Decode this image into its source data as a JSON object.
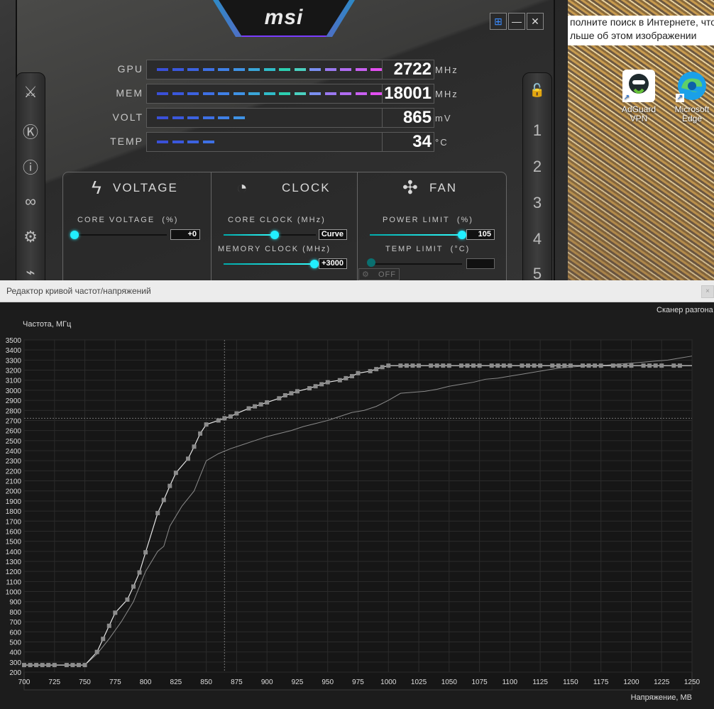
{
  "desktop": {
    "search_hint_line1": "полните поиск в Интернете, что",
    "search_hint_line2": "льше об этом изображении",
    "icons": [
      {
        "label_line1": "AdGuard",
        "label_line2": "VPN",
        "icon": "adguard-vpn-icon",
        "color": "#ffffff"
      },
      {
        "label_line1": "Microsoft",
        "label_line2": "Edge",
        "icon": "edge-icon",
        "color": "#1aa0e8"
      }
    ]
  },
  "msi": {
    "logo": "msi",
    "window_buttons": {
      "windows": "⊞",
      "minimize": "—",
      "close": "✕"
    },
    "left_rail": [
      "oc-scanner-icon",
      "k-icon",
      "info-icon",
      "oc-icon",
      "settings-icon",
      "monitor-icon"
    ],
    "left_rail_glyphs": [
      "⚔",
      "Ⓚ",
      "ⓘ",
      "∞",
      "⚙",
      "⌁"
    ],
    "profiles": {
      "lock_glyph": "🔓",
      "slots": [
        "1",
        "2",
        "3",
        "4",
        "5"
      ]
    },
    "stats": [
      {
        "label": "GPU",
        "value": "2722",
        "unit": "MHz",
        "segments": 15
      },
      {
        "label": "MEM",
        "value": "18001",
        "unit": "MHz",
        "segments": 15
      },
      {
        "label": "VOLT",
        "value": "865",
        "unit": "mV",
        "segments": 6
      },
      {
        "label": "TEMP",
        "value": "34",
        "unit": "°C",
        "segments": 4
      }
    ],
    "sections": {
      "voltage": {
        "title": "VOLTAGE",
        "glyph": "ϟ"
      },
      "clock": {
        "title": "CLOCK",
        "glyph": "◔"
      },
      "fan": {
        "title": "FAN",
        "glyph": "✣"
      }
    },
    "controls": {
      "core_voltage": {
        "label": "CORE VOLTAGE",
        "unit": "(%)",
        "value": "+0",
        "level": 0.0
      },
      "core_clock": {
        "label": "CORE CLOCK",
        "unit": "(MHz)",
        "value": "Curve",
        "level": 0.57
      },
      "memory_clock": {
        "label": "MEMORY CLOCK",
        "unit": "(MHz)",
        "value": "+3000",
        "level": 1.0
      },
      "power_limit": {
        "label": "POWER LIMIT",
        "unit": "(%)",
        "value": "105",
        "level": 1.0
      },
      "temp_limit": {
        "label": "TEMP LIMIT",
        "unit": "(°C)",
        "value": "",
        "level": 0.0
      },
      "fan_toggle": "OFF"
    }
  },
  "editor": {
    "title": "Редактор кривой частот/напряжений",
    "close": "×",
    "scanner_link": "Сканер разгона"
  },
  "chart_data": {
    "type": "line",
    "ylabel": "Частота, МГц",
    "xlabel": "Напряжение, МВ",
    "xlim": [
      700,
      1250
    ],
    "ylim": [
      200,
      3500
    ],
    "xticks": [
      700,
      725,
      750,
      775,
      800,
      825,
      850,
      875,
      900,
      925,
      950,
      975,
      1000,
      1025,
      1050,
      1075,
      1100,
      1125,
      1150,
      1175,
      1200,
      1225,
      1250
    ],
    "yticks": [
      200,
      300,
      400,
      500,
      600,
      700,
      800,
      900,
      1000,
      1100,
      1200,
      1300,
      1400,
      1500,
      1600,
      1700,
      1800,
      1900,
      2000,
      2100,
      2200,
      2300,
      2400,
      2500,
      2600,
      2700,
      2800,
      2900,
      3000,
      3100,
      3200,
      3300,
      3400,
      3500
    ],
    "grid": true,
    "current_point": {
      "x": 865,
      "y": 2722
    },
    "series": [
      {
        "role": "edited-curve",
        "color": "#e6e6e6",
        "x": [
          700,
          705,
          710,
          715,
          720,
          725,
          735,
          740,
          745,
          750,
          760,
          765,
          770,
          775,
          785,
          790,
          795,
          800,
          810,
          815,
          820,
          825,
          835,
          840,
          845,
          850,
          860,
          865,
          870,
          875,
          885,
          890,
          895,
          900,
          910,
          915,
          920,
          925,
          935,
          940,
          945,
          950,
          960,
          965,
          970,
          975,
          985,
          990,
          995,
          1000,
          1010,
          1015,
          1020,
          1025,
          1035,
          1040,
          1045,
          1050,
          1060,
          1065,
          1070,
          1075,
          1085,
          1090,
          1095,
          1100,
          1110,
          1115,
          1120,
          1125,
          1135,
          1140,
          1145,
          1150,
          1160,
          1165,
          1170,
          1175,
          1185,
          1190,
          1195,
          1200,
          1210,
          1215,
          1220,
          1225,
          1235,
          1240
        ],
        "y": [
          270,
          270,
          270,
          270,
          270,
          270,
          270,
          270,
          270,
          270,
          400,
          530,
          660,
          790,
          920,
          1050,
          1190,
          1390,
          1780,
          1910,
          2050,
          2180,
          2320,
          2440,
          2570,
          2660,
          2700,
          2722,
          2740,
          2770,
          2820,
          2840,
          2860,
          2880,
          2920,
          2950,
          2970,
          2990,
          3020,
          3040,
          3060,
          3080,
          3100,
          3120,
          3140,
          3170,
          3190,
          3210,
          3230,
          3245,
          3245,
          3245,
          3245,
          3245,
          3245,
          3245,
          3245,
          3245,
          3245,
          3245,
          3245,
          3245,
          3245,
          3245,
          3245,
          3245,
          3245,
          3245,
          3245,
          3245,
          3245,
          3245,
          3245,
          3245,
          3245,
          3245,
          3245,
          3245,
          3245,
          3245,
          3245,
          3245,
          3245,
          3245,
          3245,
          3245,
          3245,
          3245
        ],
        "line_x_end": 1250
      },
      {
        "role": "default-curve",
        "color": "#8a8a8a",
        "x": [
          700,
          750,
          760,
          770,
          780,
          790,
          800,
          810,
          815,
          820,
          830,
          840,
          850,
          860,
          870,
          880,
          890,
          900,
          910,
          920,
          930,
          940,
          950,
          960,
          970,
          980,
          990,
          1000,
          1010,
          1020,
          1030,
          1040,
          1050,
          1060,
          1070,
          1080,
          1090,
          1100,
          1110,
          1120,
          1130,
          1140,
          1150,
          1160,
          1170,
          1180,
          1190,
          1200,
          1210,
          1220,
          1230,
          1240,
          1250
        ],
        "y": [
          270,
          270,
          380,
          530,
          700,
          900,
          1200,
          1400,
          1450,
          1650,
          1850,
          2000,
          2300,
          2370,
          2420,
          2460,
          2500,
          2540,
          2570,
          2600,
          2640,
          2670,
          2700,
          2740,
          2780,
          2800,
          2840,
          2900,
          2970,
          2980,
          2990,
          3010,
          3040,
          3060,
          3080,
          3110,
          3120,
          3140,
          3160,
          3180,
          3200,
          3220,
          3230,
          3240,
          3245,
          3250,
          3260,
          3270,
          3280,
          3290,
          3300,
          3320,
          3340
        ]
      }
    ]
  }
}
